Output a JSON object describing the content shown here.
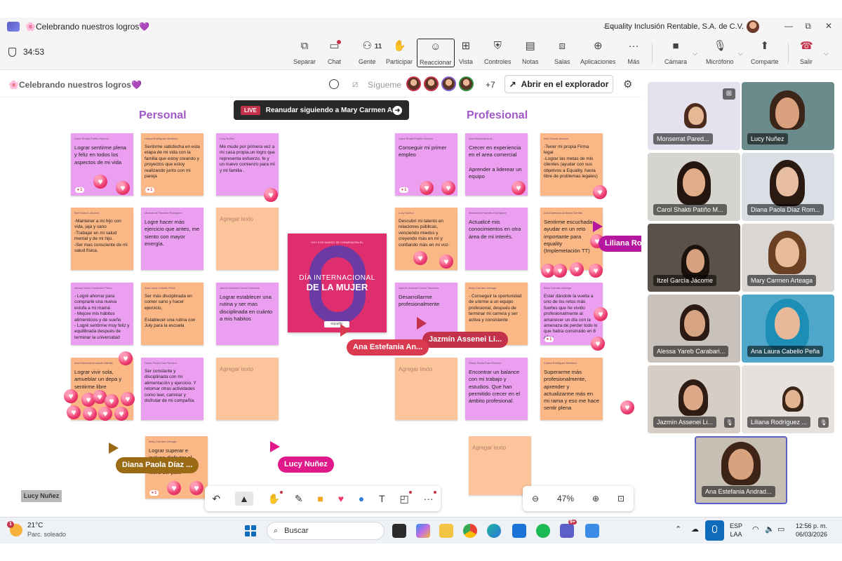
{
  "title_bar": {
    "meeting_title": "🌸Celebrando nuestros logros💜",
    "organization": "Equality Inclusión Rentable, S.A. de C.V.",
    "more": "···",
    "minimize": "—",
    "restore": "⧉",
    "close": "✕"
  },
  "toolbar": {
    "timer": "34:53",
    "people_count": "11",
    "buttons": [
      {
        "label": "Separar",
        "icon": "share-out-icon"
      },
      {
        "label": "Chat",
        "icon": "chat-icon"
      },
      {
        "label": "Gente",
        "icon": "people-icon"
      },
      {
        "label": "Participar",
        "icon": "raise-hand-icon"
      },
      {
        "label": "Reaccionar",
        "icon": "smiley-icon"
      },
      {
        "label": "Vista",
        "icon": "grid-view-icon"
      },
      {
        "label": "Controles",
        "icon": "shield-settings-icon"
      },
      {
        "label": "Notas",
        "icon": "notes-icon"
      },
      {
        "label": "Salas",
        "icon": "rooms-icon"
      },
      {
        "label": "Aplicaciones",
        "icon": "add-apps-icon"
      },
      {
        "label": "Más",
        "icon": "more-icon"
      },
      {
        "label": "Cámara",
        "icon": "camera-icon"
      },
      {
        "label": "Micrófono",
        "icon": "microphone-icon"
      },
      {
        "label": "Comparte",
        "icon": "share-screen-icon"
      },
      {
        "label": "Salir",
        "icon": "hang-up-icon"
      }
    ]
  },
  "whiteboard_header": {
    "title": "🌸Celebrando nuestros logros💜",
    "follow_label": "Sígueme",
    "extra_participants": "+7",
    "open_browser_label": "Abrir en el explorador"
  },
  "canvas": {
    "section_personal": "Personal",
    "section_professional": "Profesional",
    "live_badge": "LIVE",
    "resume_following": "Reanudar siguiendo a Mary Carmen Ar...",
    "placeholder": "Agregar texto",
    "poster": {
      "tagline": "HOY 8 DE MARZO SE CONMEMORA EL",
      "line1": "DÍA INTERNACIONAL",
      "line2": "DE LA MUJER",
      "brand": "equality"
    },
    "notes": [
      {
        "author": "Carol Shakti Patiño Moreno",
        "text": "Lograr sentirme plena y feliz en todos los aspectos de mi vida",
        "reaction": "1"
      },
      {
        "author": "Liliana Rodriguez Martinez",
        "text": "Sentirme satisfecha en esta etapa de mi vida con la familia que estoy creando y proyectos que estoy realizando junto con mi pareja",
        "reaction": "1"
      },
      {
        "author": "Lucy Nuñez",
        "text": "Me mude por primera vez a mi casa propia,un logro que representa esfuerzo, fe y un nuevo comienzo para mí y mi familia .",
        "reaction": ""
      },
      {
        "author": "Carol Shakti Patiño Moreno",
        "text": "Conseguir mi primer empleo",
        "reaction": "1"
      },
      {
        "author": "Ana Estefania And...",
        "text": "Crecer en experiencia en el area comercial\n\nAprender a liderear un equipo",
        "reaction": ""
      },
      {
        "author": "Itzel Garcia Jácome",
        "text": "-Tener mi propia Firma legal\n-Lograr las metas de mis clientes (ayudar con sus objetivos a Equality, hasta libre de problemas legales)",
        "reaction": ""
      },
      {
        "author": "Itzel García Jácome",
        "text": "-Mantener a mi hijo con vida, jaja y sano\n-Trabajar en mi salud mental y de mi hijo.\n-Ser mas consciente de mi salud física.",
        "reaction": ""
      },
      {
        "author": "Monserrat Paredes Rodriguez",
        "text": "Logre hacer más ejercicio que antes, me siento con mayor energía.",
        "reaction": ""
      },
      {
        "author": "Lucy Muñoz",
        "text": "Descubrí mi talento en relaciones públicas, venciendo miedos y creyendo más en mí y confiando más en mi voz-",
        "reaction": ""
      },
      {
        "author": "Monserrat Paredes Rodriguez",
        "text": "Actualicé mis conocimientos en otra área de mi interés.",
        "reaction": ""
      },
      {
        "author": "Ana Estefania Andrade Garfias",
        "text": "Sentirme escuchada, ayudar en un reto importante para equality (Implemetación TT)",
        "reaction": ""
      },
      {
        "author": "Alessa Yareb Carabarin Pérez",
        "text": "- Logré ahorrar para comprarle una nueva estufa a mi mamá\n- Mejore mis hábitos alimenticios y de sueño\n- Logré sentirme muy feliz y equilibrada después de terminar la universidad",
        "reaction": ""
      },
      {
        "author": "Ana Laura Cabello Peña",
        "text": "Ser más disciplinada en comer sano y hacer ejercicio,\n\nEstablecer una rutina con July para la escuela",
        "reaction": ""
      },
      {
        "author": "Jazmín Assenei Limón Saucedo",
        "text": "Lograr establecer una rutina y ser mas disciplinada en cuánto a mis habitos",
        "reaction": ""
      },
      {
        "author": "Jazmín Assenei Limón Saucedo",
        "text": "Desarrollarme profesionalmente",
        "reaction": ""
      },
      {
        "author": "Mary Carmen Arteaga",
        "text": "- Conseguir la oportunidad de unirme a un equipo profesional, después de terminar mi carrera y ser activa y consistente",
        "reaction": ""
      },
      {
        "author": "Mary Carmen Arteaga",
        "text": "Estar dándole la vuelta a uno de los retos más fuertes que he vivido profesionalmente al amanecer un día con la amenaza de perder todo lo que había construido en 8 años",
        "reaction": "1"
      },
      {
        "author": "Ana Estefania Andrade Garfias",
        "text": "Lograr vivir sola, amueblar un depa y sentirme libre",
        "reaction": ""
      },
      {
        "author": "Diana Paola Díaz Romero",
        "text": "Ser constante y disciplinada con mi alimentación y ejercicio. Y retomar otras actividades como leer, caminar y disfrutar de mi compañía.",
        "reaction": ""
      },
      {
        "author": "Diana Paola Díaz Romero",
        "text": "Encontrar un balance con mi trabajo y estudios. Que han permitido crecer en el ámbito profesional.",
        "reaction": ""
      },
      {
        "author": "Liliana Rodriguez Martinez",
        "text": "Superarme más profesionalmente, aprender y actualizarme más en mi rama y eso me hace sentir plena",
        "reaction": ""
      },
      {
        "author": "Mary Carmen Arteaga",
        "text": "Lograr superar e incluso disfrutar el miedo de estudiar fuera del país",
        "reaction": "1"
      }
    ],
    "cursors": [
      {
        "name": "Liliana Ro",
        "color": "#b5179e"
      },
      {
        "name": "Ana Estefania An...",
        "color": "#d93a4f"
      },
      {
        "name": "Jazmín Assenei Li...",
        "color": "#c4314b"
      },
      {
        "name": "Diana Paola Díaz ...",
        "color": "#9a6a15"
      },
      {
        "name": "Lucy Nuñez",
        "color": "#e0198a"
      }
    ],
    "bottom_left_tag": "Lucy Nuñez",
    "zoom_level": "47%"
  },
  "gallery": [
    {
      "name": "Monserrat Pared...",
      "bg": "#e4e2ee"
    },
    {
      "name": "Lucy Nuñez",
      "bg": "#6b8a8b"
    },
    {
      "name": "Carol Shakti Patiño M...",
      "bg": "#d6d4cf"
    },
    {
      "name": "Diana Paola Díaz Rom...",
      "bg": "#dadfe6"
    },
    {
      "name": "Itzel García Jácome",
      "bg": "#5a5248"
    },
    {
      "name": "Mary Carmen Arteaga",
      "bg": "#d9d6d3"
    },
    {
      "name": "Alessa Yareb Carabari...",
      "bg": "#c9c2bc"
    },
    {
      "name": "Ana Laura Cabello Peña",
      "bg": "#4fa8c9"
    },
    {
      "name": "Jazmín Assenei Li...",
      "bg": "#d6cdc5"
    },
    {
      "name": "Liliana Rodríguez ...",
      "bg": "#e7e1de"
    },
    {
      "name": "Ana Estefania Andrad...",
      "bg": "#c7bfb4"
    }
  ],
  "taskbar": {
    "temperature": "21°C",
    "weather": "Parc. soleado",
    "weather_badge": "1",
    "search_placeholder": "Buscar",
    "language_1": "ESP",
    "language_2": "LAA",
    "time": "12:56 p. m.",
    "date": "06/03/2026",
    "teams_badge": "9+"
  }
}
